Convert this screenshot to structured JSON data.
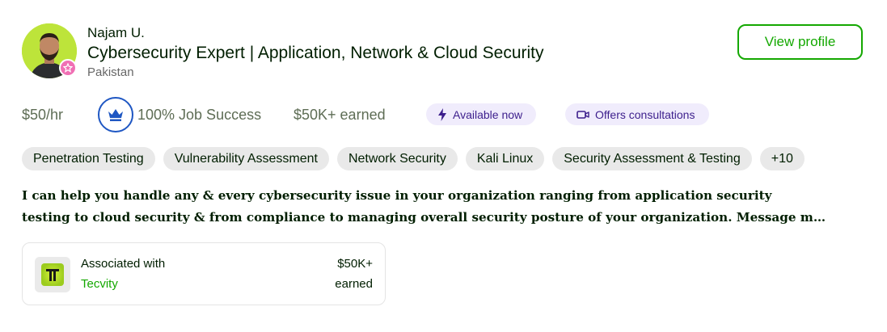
{
  "freelancer": {
    "name": "Najam U.",
    "title": "Cybersecurity Expert | Application, Network & Cloud Security",
    "location": "Pakistan"
  },
  "actions": {
    "view_profile_label": "View profile"
  },
  "stats": {
    "rate": "$50/hr",
    "job_success": "100% Job Success",
    "earned": "$50K+ earned"
  },
  "badges": {
    "available": "Available now",
    "consultations": "Offers consultations"
  },
  "skills": [
    "Penetration Testing",
    "Vulnerability Assessment",
    "Network Security",
    "Kali Linux",
    "Security Assessment & Testing",
    "+10"
  ],
  "description": {
    "line1": "I can help you handle any & every cybersecurity issue in your organization ranging from application security",
    "line2": "testing to cloud security & from compliance to managing overall security posture of your organization. Message m…"
  },
  "association": {
    "label": "Associated with",
    "company": "Tecvity",
    "amount": "$50K+",
    "amount_suffix": "earned"
  },
  "colors": {
    "brand_green": "#14a800",
    "badge_purple_bg": "#f0ecfc",
    "badge_purple_text": "#3c1e8c",
    "job_success_blue": "#1f57c3",
    "top_rated_pink": "#f06fb4"
  },
  "icons": {
    "avatar": "profile-photo",
    "top_rated": "star-badge-icon",
    "job_success": "crown-icon",
    "available": "lightning-icon",
    "consultations": "video-camera-icon",
    "company_logo": "tecvity-logo"
  }
}
